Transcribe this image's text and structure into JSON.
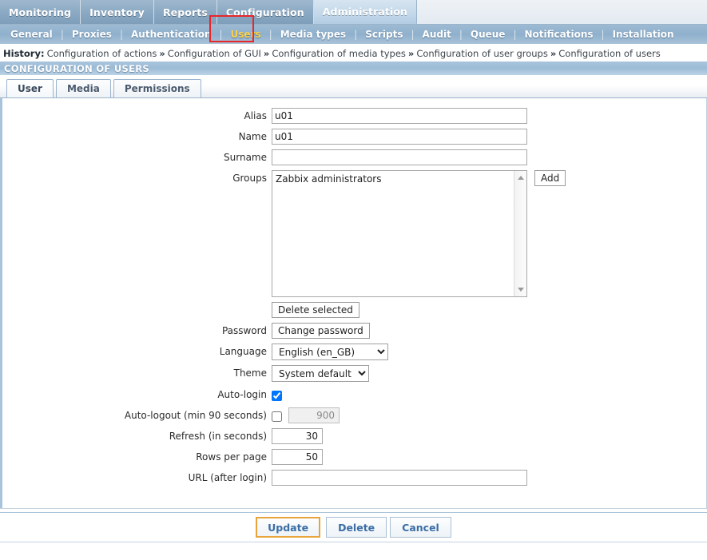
{
  "main_nav": {
    "items": [
      {
        "label": "Monitoring",
        "active": false
      },
      {
        "label": "Inventory",
        "active": false
      },
      {
        "label": "Reports",
        "active": false
      },
      {
        "label": "Configuration",
        "active": false
      },
      {
        "label": "Administration",
        "active": true
      }
    ]
  },
  "sub_nav": {
    "items": [
      {
        "label": "General",
        "selected": false
      },
      {
        "label": "Proxies",
        "selected": false
      },
      {
        "label": "Authentication",
        "selected": false
      },
      {
        "label": "Users",
        "selected": true
      },
      {
        "label": "Media types",
        "selected": false
      },
      {
        "label": "Scripts",
        "selected": false
      },
      {
        "label": "Audit",
        "selected": false
      },
      {
        "label": "Queue",
        "selected": false
      },
      {
        "label": "Notifications",
        "selected": false
      },
      {
        "label": "Installation",
        "selected": false
      }
    ],
    "separator": "|",
    "highlight_color": "#e8262a",
    "selected_color": "#ffd24a"
  },
  "history": {
    "label": "History:",
    "separator": "»",
    "items": [
      "Configuration of actions",
      "Configuration of GUI",
      "Configuration of media types",
      "Configuration of user groups",
      "Configuration of users"
    ]
  },
  "page_title": "CONFIGURATION OF USERS",
  "tabs": [
    {
      "label": "User",
      "active": true
    },
    {
      "label": "Media",
      "active": false
    },
    {
      "label": "Permissions",
      "active": false
    }
  ],
  "form": {
    "alias": {
      "label": "Alias",
      "value": "u01",
      "placeholder": ""
    },
    "name": {
      "label": "Name",
      "value": "u01",
      "placeholder": ""
    },
    "surname": {
      "label": "Surname",
      "value": "",
      "placeholder": ""
    },
    "groups": {
      "label": "Groups",
      "items": [
        "Zabbix administrators"
      ],
      "add_label": "Add",
      "delete_label": "Delete selected",
      "scroll_up_icon": "arrow-up-icon",
      "scroll_down_icon": "arrow-down-icon"
    },
    "password": {
      "label": "Password",
      "button_label": "Change password"
    },
    "language": {
      "label": "Language",
      "value": "English (en_GB)",
      "options": [
        "English (en_GB)"
      ]
    },
    "theme": {
      "label": "Theme",
      "value": "System default",
      "options": [
        "System default"
      ]
    },
    "auto_login": {
      "label": "Auto-login",
      "checked": true
    },
    "auto_logout": {
      "label": "Auto-logout (min 90 seconds)",
      "checked": false,
      "value": "900",
      "disabled": true
    },
    "refresh": {
      "label": "Refresh (in seconds)",
      "value": "30"
    },
    "rows_per_page": {
      "label": "Rows per page",
      "value": "50"
    },
    "url_after_login": {
      "label": "URL (after login)",
      "value": "",
      "placeholder": ""
    }
  },
  "footer": {
    "update_label": "Update",
    "delete_label": "Delete",
    "cancel_label": "Cancel",
    "primary_border_color": "#e8a33d"
  }
}
